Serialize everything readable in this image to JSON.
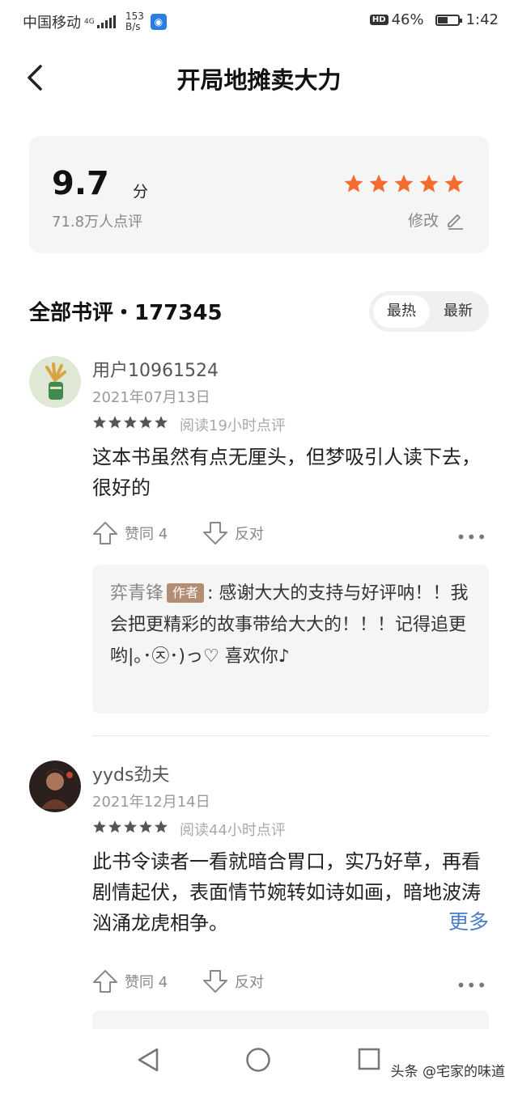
{
  "status_bar": {
    "carrier": "中国移动",
    "network": "4G",
    "speed_value": "153",
    "speed_unit": "B/s",
    "battery": "46%",
    "time": "1:42"
  },
  "header": {
    "title": "开局地摊卖大力"
  },
  "rating": {
    "score": "9.7",
    "unit": "分",
    "count": "71.8万人点评",
    "edit_label": "修改",
    "stars": 5,
    "star_color": "#f36b2e"
  },
  "reviews_section": {
    "title": "全部书评・177345",
    "sort_options": [
      "最热",
      "最新"
    ],
    "active_sort": "最热"
  },
  "reviews": [
    {
      "username": "用户10961524",
      "date": "2021年07月13日",
      "stars": 5,
      "read_note": "阅读19小时点评",
      "text": "这本书虽然有点无厘头，但梦吸引人读下去，很好的",
      "like_label": "赞同 4",
      "dislike_label": "反对",
      "reply": {
        "author": "弈青锋",
        "tag": "作者",
        "text": ": 感谢大大的支持与好评呐！！我会把更精彩的故事带给大大的！！！记得追更哟|｡･㉨･)っ♡ 喜欢你♪"
      }
    },
    {
      "username": "yyds劲夫",
      "date": "2021年12月14日",
      "stars": 5,
      "read_note": "阅读44小时点评",
      "text": "此书令读者一看就暗合胃口，实乃好草，再看剧情起伏，表面情节婉转如诗如画，暗地波涛汹涌龙虎相争。",
      "more_label": "更多",
      "like_label": "赞同 4",
      "dislike_label": "反对"
    }
  ],
  "footer": {
    "watermark": "头条 @宅家的味道"
  },
  "colors": {
    "accent_orange": "#f36b2e",
    "link_blue": "#4a7cc7",
    "author_tag": "#b38c72"
  }
}
